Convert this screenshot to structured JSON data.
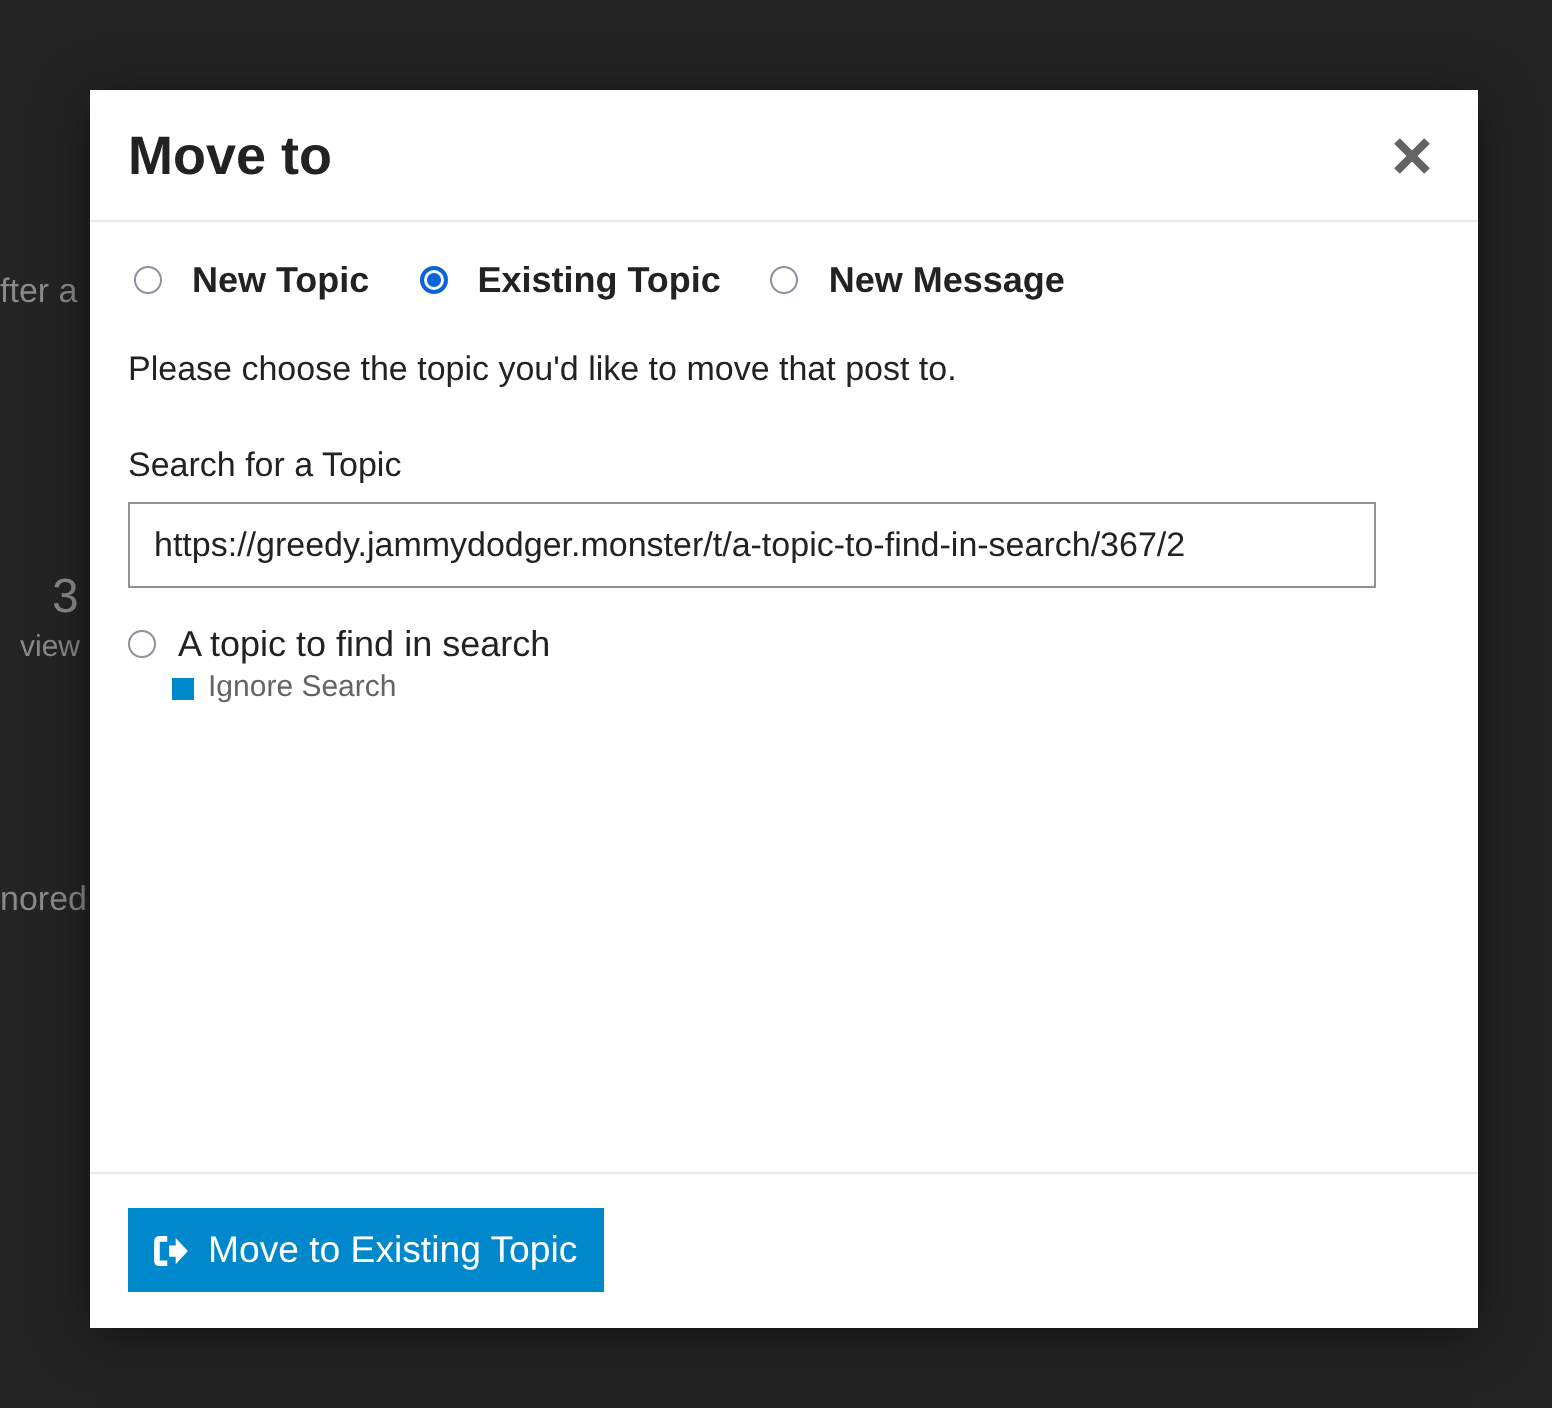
{
  "background_page": {
    "fragments": [
      {
        "kind": "text",
        "text": "fter a"
      },
      {
        "kind": "count",
        "text": "3"
      },
      {
        "kind": "count_label",
        "text": "view"
      },
      {
        "kind": "text",
        "text": "nored"
      }
    ]
  },
  "dialog": {
    "title": "Move to",
    "options": [
      {
        "label": "New Topic",
        "selected": false
      },
      {
        "label": "Existing Topic",
        "selected": true
      },
      {
        "label": "New Message",
        "selected": false
      }
    ],
    "instructions": "Please choose the topic you'd like to move that post to.",
    "search": {
      "label": "Search for a Topic",
      "value": "https://greedy.jammydodger.monster/t/a-topic-to-find-in-search/367/2"
    },
    "results": [
      {
        "title": "A topic to find in search",
        "selected": false,
        "category": {
          "name": "Ignore Search",
          "color": "#0088cc"
        }
      }
    ],
    "primary_button": {
      "label": "Move to Existing Topic"
    }
  }
}
